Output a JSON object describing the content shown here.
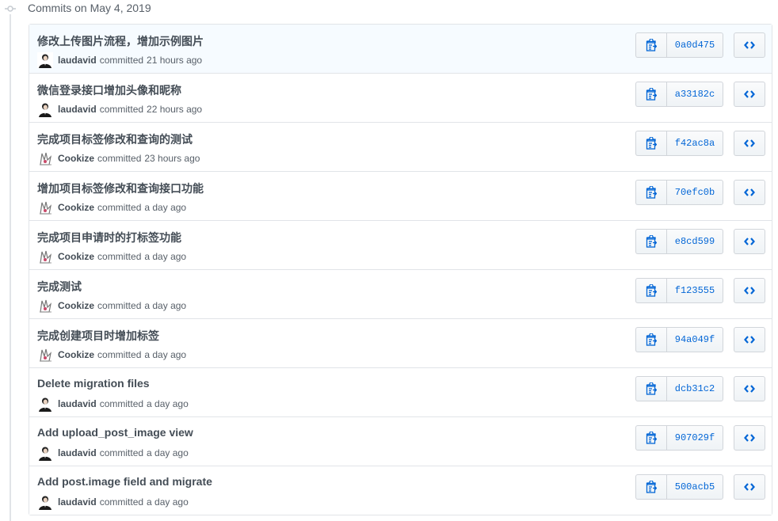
{
  "group": {
    "title": "Commits on May 4, 2019"
  },
  "commits": [
    {
      "title": "修改上传图片流程，增加示例图片",
      "author": "laudavid",
      "verb": "committed",
      "time": "21 hours ago",
      "sha": "0a0d475",
      "avatar": "laudavid"
    },
    {
      "title": "微信登录接口增加头像和昵称",
      "author": "laudavid",
      "verb": "committed",
      "time": "22 hours ago",
      "sha": "a33182c",
      "avatar": "laudavid"
    },
    {
      "title": "完成项目标签修改和查询的测试",
      "author": "Cookize",
      "verb": "committed",
      "time": "23 hours ago",
      "sha": "f42ac8a",
      "avatar": "cookize"
    },
    {
      "title": "增加项目标签修改和查询接口功能",
      "author": "Cookize",
      "verb": "committed",
      "time": "a day ago",
      "sha": "70efc0b",
      "avatar": "cookize"
    },
    {
      "title": "完成项目申请时的打标签功能",
      "author": "Cookize",
      "verb": "committed",
      "time": "a day ago",
      "sha": "e8cd599",
      "avatar": "cookize"
    },
    {
      "title": "完成测试",
      "author": "Cookize",
      "verb": "committed",
      "time": "a day ago",
      "sha": "f123555",
      "avatar": "cookize"
    },
    {
      "title": "完成创建项目时增加标签",
      "author": "Cookize",
      "verb": "committed",
      "time": "a day ago",
      "sha": "94a049f",
      "avatar": "cookize"
    },
    {
      "title": "Delete migration files",
      "author": "laudavid",
      "verb": "committed",
      "time": "a day ago",
      "sha": "dcb31c2",
      "avatar": "laudavid"
    },
    {
      "title": "Add upload_post_image view",
      "author": "laudavid",
      "verb": "committed",
      "time": "a day ago",
      "sha": "907029f",
      "avatar": "laudavid"
    },
    {
      "title": "Add post.image field and migrate",
      "author": "laudavid",
      "verb": "committed",
      "time": "a day ago",
      "sha": "500acb5",
      "avatar": "laudavid"
    }
  ],
  "icons": {
    "timeline": "git-commit-icon",
    "copy": "clippy-icon",
    "browse": "code-icon"
  },
  "colors": {
    "link": "#0366d6",
    "first_row_bg": "#f6fbff",
    "border": "#e1e4e8"
  }
}
